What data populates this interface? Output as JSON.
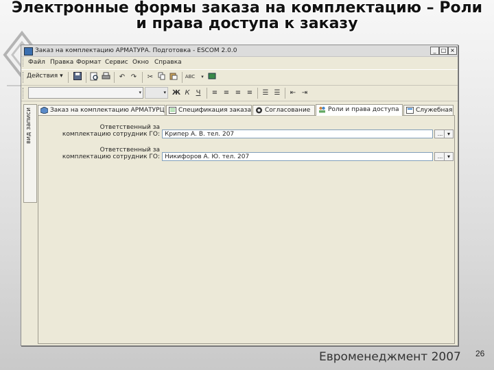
{
  "slide": {
    "title_line1": "Электронные формы заказа на комплектацию – Роли",
    "title_line2": "и права доступа к заказу",
    "footer": "Евроменеджмент 2007",
    "page_number": "26"
  },
  "window": {
    "title": "Заказ на комплектацию АРМАТУРА. Подготовка - ESCOM 2.0.0",
    "buttons": {
      "minimize": "_",
      "maximize": "□",
      "close": "×"
    }
  },
  "menu": [
    "Файл",
    "Правка",
    "Формат",
    "Сервис",
    "Окно",
    "Справка"
  ],
  "toolbar": {
    "actions_label": "Действия",
    "actions_arrow": "▾",
    "icons": [
      "save-icon",
      "print-preview-icon",
      "print-icon",
      "undo-icon",
      "redo-icon",
      "cut-icon",
      "copy-icon",
      "paste-icon",
      "spellcheck-icon",
      "book-icon"
    ],
    "format": {
      "bold": "Ж",
      "italic": "К",
      "underline": "Ч",
      "combo_arrow": "▾"
    }
  },
  "side_tab": {
    "label": "вид записи"
  },
  "tabs": [
    {
      "label": "Заказ на комплектацию АРМАТУРЦ",
      "icon": "order-icon",
      "active": false
    },
    {
      "label": "Спецификация заказа",
      "icon": "spec-icon",
      "active": false
    },
    {
      "label": "Согласование",
      "icon": "approval-icon",
      "active": false
    },
    {
      "label": "Роли и права доступа",
      "icon": "roles-icon",
      "active": true
    },
    {
      "label": "Служебная",
      "icon": "service-icon",
      "active": false
    }
  ],
  "fields": [
    {
      "label_line1": "Ответственный за",
      "label_line2": "комплектацию сотрудник ГО:",
      "value": "Крипер А. В. тел. 207",
      "button": "...",
      "dropdown": "▾"
    },
    {
      "label_line1": "Ответственный за",
      "label_line2": "комплектацию сотрудник ГО:",
      "value": "Никифоров А. Ю. тел. 207",
      "button": "...",
      "dropdown": "▾"
    }
  ]
}
